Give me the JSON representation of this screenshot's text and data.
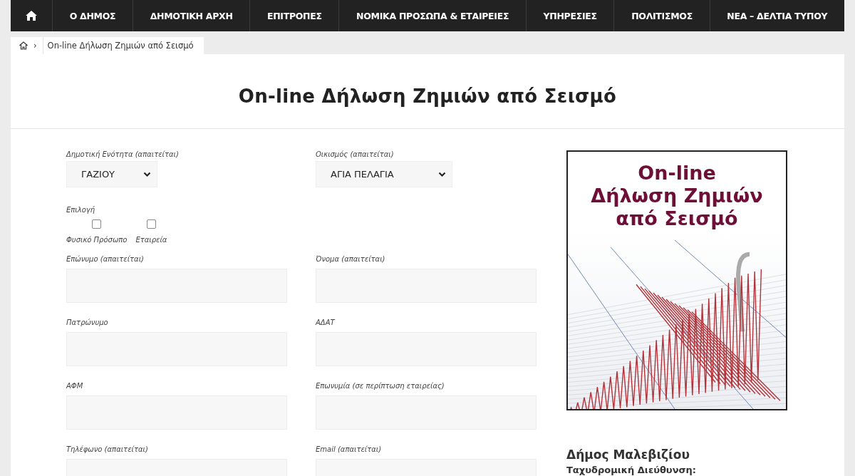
{
  "nav": {
    "items": [
      {
        "label": "Ο ΔΗΜΟΣ"
      },
      {
        "label": "ΔΗΜΟΤΙΚΗ ΑΡΧΗ"
      },
      {
        "label": "ΕΠΙΤΡΟΠΕΣ"
      },
      {
        "label": "ΝΟΜΙΚΑ ΠΡΟΣΩΠΑ & ΕΤΑΙΡΕΙΕΣ"
      },
      {
        "label": "ΥΠΗΡΕΣΙΕΣ"
      },
      {
        "label": "ΠΟΛΙΤΙΣΜΟΣ"
      },
      {
        "label": "ΝΕΑ – ΔΕΛΤΙΑ ΤΥΠΟΥ"
      }
    ]
  },
  "breadcrumb": {
    "separator": "›",
    "current": "On-line Δήλωση Ζημιών από Σεισμό"
  },
  "page_title": "On-line Δήλωση Ζημιών από Σεισμό",
  "form": {
    "selects": [
      {
        "label": "Δημοτική Ενότητα (απαιτείται)",
        "value": "ΓΑΖΙΟΥ"
      },
      {
        "label": "Οικισμός (απαιτείται)",
        "value": "ΑΓΙΑ ΠΕΛΑΓΙΑ"
      }
    ],
    "choice": {
      "label": "Επιλογή",
      "options": [
        {
          "label": "Φυσικό Πρόσωπο",
          "checked": false
        },
        {
          "label": "Εταιρεία",
          "checked": false
        }
      ]
    },
    "fields": [
      {
        "label": "Επώνυμο (απαιτείται)"
      },
      {
        "label": "Όνομα (απαιτείται)"
      },
      {
        "label": "Πατρώνυμο"
      },
      {
        "label": "ΑΔΑΤ"
      },
      {
        "label": "ΑΦΜ"
      },
      {
        "label": "Επωνυμία (σε περίπτωση εταιρείας)"
      },
      {
        "label": "Τηλέφωνο (απαιτείται)"
      },
      {
        "label": "Email (απαιτείται)"
      }
    ]
  },
  "sidebar": {
    "banner_lines": [
      "On-line",
      "Δήλωση Ζημιών",
      "από Σεισμό"
    ],
    "org_name": "Δήμος Μαλεβιζίου",
    "address_label": "Ταχυδρομική Διεύθυνση:"
  }
}
